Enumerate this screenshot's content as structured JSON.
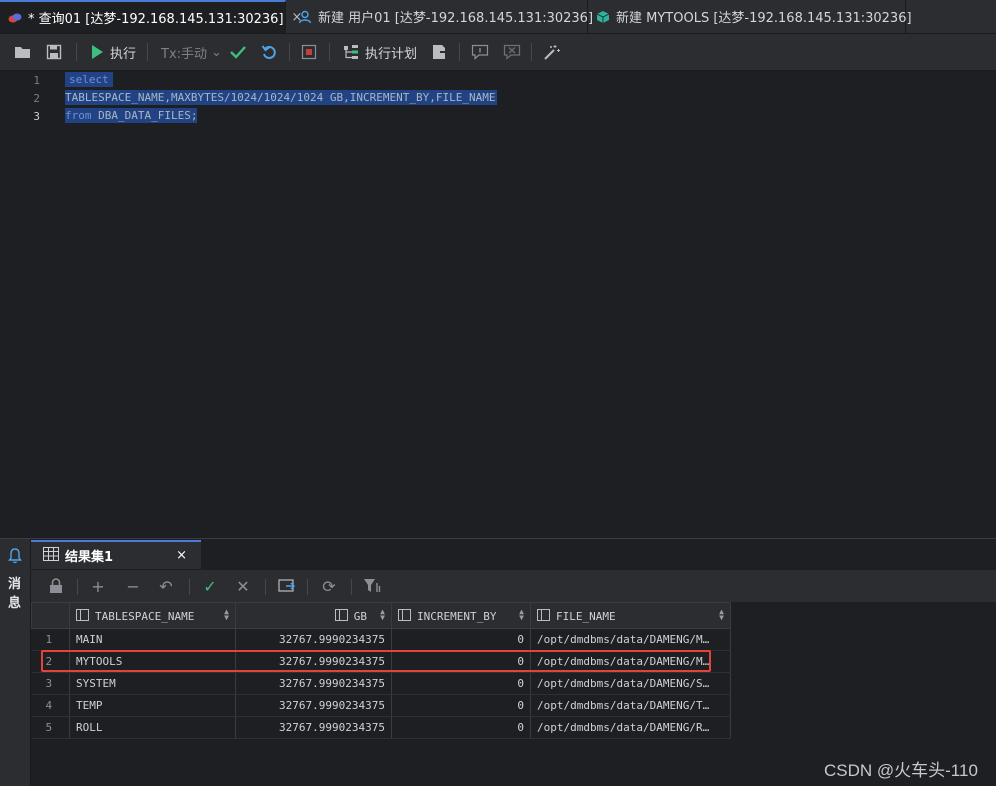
{
  "tabs": [
    {
      "label": "* 查询01 [达梦-192.168.145.131:30236]",
      "close": "×"
    },
    {
      "label": "新建 用户01 [达梦-192.168.145.131:30236]"
    },
    {
      "label": "新建 MYTOOLS [达梦-192.168.145.131:30236]"
    }
  ],
  "toolbar": {
    "run_label": "执行",
    "tx_label": "Tx:手动",
    "plan_label": "执行计划"
  },
  "editor": {
    "line_numbers": [
      "1",
      "2",
      "3"
    ],
    "lines": [
      {
        "kw": "select",
        "rest": ""
      },
      {
        "kw": "",
        "rest": "TABLESPACE_NAME,MAXBYTES/1024/1024/1024 GB,INCREMENT_BY,FILE_NAME"
      },
      {
        "kw": "from",
        "rest": " DBA_DATA_FILES;"
      }
    ]
  },
  "messages_label_1": "消",
  "messages_label_2": "息",
  "result_tab": {
    "label": "结果集1",
    "close": "×"
  },
  "grid": {
    "columns": [
      "TABLESPACE_NAME",
      "GB",
      "INCREMENT_BY",
      "FILE_NAME"
    ],
    "rows": [
      [
        "1",
        "MAIN",
        "32767.9990234375",
        "0",
        "/opt/dmdbms/data/DAMENG/M…"
      ],
      [
        "2",
        "MYTOOLS",
        "32767.9990234375",
        "0",
        "/opt/dmdbms/data/DAMENG/M…"
      ],
      [
        "3",
        "SYSTEM",
        "32767.9990234375",
        "0",
        "/opt/dmdbms/data/DAMENG/S…"
      ],
      [
        "4",
        "TEMP",
        "32767.9990234375",
        "0",
        "/opt/dmdbms/data/DAMENG/T…"
      ],
      [
        "5",
        "ROLL",
        "32767.9990234375",
        "0",
        "/opt/dmdbms/data/DAMENG/R…"
      ]
    ]
  },
  "watermark": "CSDN @火车头-110",
  "colors": {
    "accent": "#4a7bd6",
    "run_green": "#3fbf7f",
    "highlight_red": "#e0443a"
  }
}
